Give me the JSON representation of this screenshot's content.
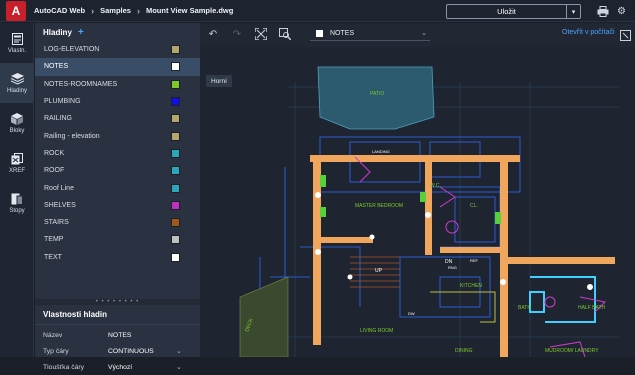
{
  "app": {
    "logo_letter": "A"
  },
  "breadcrumbs": [
    "AutoCAD Web",
    "Samples",
    "Mount View Sample.dwg"
  ],
  "topbar": {
    "save_label": "Uložit"
  },
  "rail": [
    {
      "label": "Vlastn.",
      "icon": "properties-icon"
    },
    {
      "label": "Hladiny",
      "icon": "layers-icon"
    },
    {
      "label": "Bloky",
      "icon": "blocks-icon"
    },
    {
      "label": "XREF",
      "icon": "xref-icon"
    },
    {
      "label": "Stopy",
      "icon": "traces-icon"
    }
  ],
  "layers_panel": {
    "title": "Hladiny",
    "add_symbol": "+",
    "layers": [
      {
        "name": "LOG-ELEVATION",
        "color": "#b8a56a"
      },
      {
        "name": "NOTES",
        "color": "#ffffff",
        "selected": true
      },
      {
        "name": "NOTES-ROOMNAMES",
        "color": "#7ec82a"
      },
      {
        "name": "PLUMBING",
        "color": "#1010e0"
      },
      {
        "name": "RAILING",
        "color": "#b8a56a"
      },
      {
        "name": "Railing - elevation",
        "color": "#b8a56a"
      },
      {
        "name": "ROCK",
        "color": "#2aa7b8"
      },
      {
        "name": "ROOF",
        "color": "#2aa7b8"
      },
      {
        "name": "Roof Line",
        "color": "#2aa7b8"
      },
      {
        "name": "SHELVES",
        "color": "#c030c0"
      },
      {
        "name": "STAIRS",
        "color": "#a0581a"
      },
      {
        "name": "TEMP",
        "color": "#c0c0c0"
      },
      {
        "name": "TEXT",
        "color": "#ffffff"
      }
    ]
  },
  "layer_props": {
    "title": "Vlastnosti hladin",
    "rows": [
      {
        "key": "Název",
        "value": "NOTES"
      },
      {
        "key": "Typ čáry",
        "value": "CONTINUOUS"
      },
      {
        "key": "Tloušťka čáry",
        "value": "Výchozí"
      }
    ]
  },
  "canvas": {
    "current_layer": "NOTES",
    "open_pc_label": "Otevřít v počítači",
    "view_tab": "Horní",
    "labels": [
      "PATIO",
      "LANDING",
      "W.C.",
      "MASTER BEDROOM",
      "CL.",
      "UP",
      "KITCHEN",
      "DN",
      "LIVING ROOM",
      "DINING",
      "BATH",
      "HALF BATH",
      "MUDROOM/ LAUNDRY",
      "DECK",
      "RNG",
      "DW",
      "REF"
    ]
  }
}
